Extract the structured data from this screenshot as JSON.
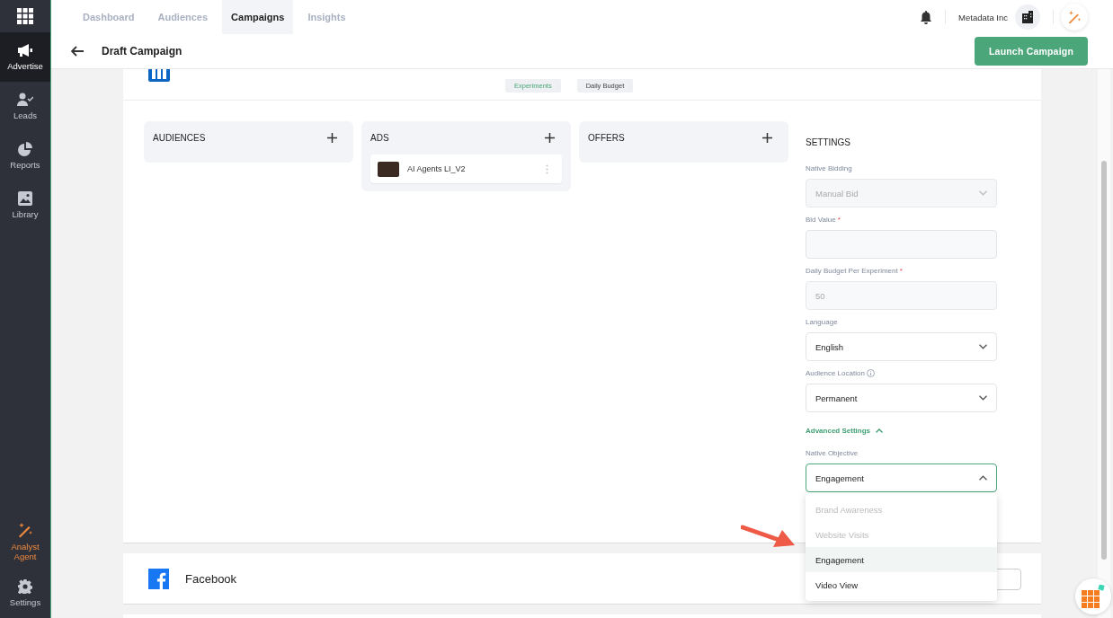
{
  "sidebar": {
    "items": [
      {
        "label": "Advertise",
        "kind": "main",
        "selected": true
      },
      {
        "label": "Leads",
        "kind": "main",
        "selected": false
      },
      {
        "label": "Reports",
        "kind": "main",
        "selected": false
      },
      {
        "label": "Library",
        "kind": "main",
        "selected": false
      },
      {
        "label": "Analyst Agent",
        "kind": "agent",
        "selected": false
      },
      {
        "label": "Settings",
        "kind": "main",
        "selected": false
      }
    ]
  },
  "nav": {
    "tabs": [
      {
        "label": "Dashboard",
        "selected": false
      },
      {
        "label": "Audiences",
        "selected": false
      },
      {
        "label": "Campaigns",
        "selected": true
      },
      {
        "label": "Insights",
        "selected": false
      }
    ],
    "account": "Metadata Inc"
  },
  "header": {
    "title": "Draft Campaign",
    "primary_button": "Launch Campaign"
  },
  "linkedin_card": {
    "chips": [
      {
        "label": "Experiments",
        "kind": "accent"
      },
      {
        "label": "Daily Budget",
        "kind": "plain"
      }
    ],
    "columns": [
      {
        "title": "AUDIENCES"
      },
      {
        "title": "ADS",
        "items": [
          {
            "name": "AI Agents LI_V2"
          }
        ]
      },
      {
        "title": "OFFERS"
      }
    ],
    "settings": {
      "title": "SETTINGS",
      "fields": [
        {
          "label": "Native Bidding",
          "kind": "select",
          "disabled": true,
          "value": "Manual Bid"
        },
        {
          "label": "Bid Value",
          "kind": "input",
          "required_mark": "*"
        },
        {
          "label": "Daily Budget Per Experiment",
          "kind": "input",
          "required_mark": "*",
          "disabled": true,
          "value": "50"
        },
        {
          "label": "Language",
          "kind": "select",
          "disabled": false,
          "value": "English"
        },
        {
          "label": "Audience Location",
          "kind": "select",
          "info": true,
          "disabled": false,
          "value": "Permanent"
        }
      ],
      "advanced": {
        "label": "Advanced Settings",
        "expanded": true
      },
      "objective": {
        "label": "Native Objective",
        "value": "Engagement",
        "open": true,
        "options": [
          {
            "label": "Brand Awareness",
            "disabled": true,
            "selected": false
          },
          {
            "label": "Website Visits",
            "disabled": true,
            "selected": false
          },
          {
            "label": "Engagement",
            "disabled": false,
            "selected": true
          },
          {
            "label": "Video View",
            "disabled": false,
            "selected": false
          }
        ]
      }
    }
  },
  "facebook_card": {
    "name": "Facebook"
  }
}
